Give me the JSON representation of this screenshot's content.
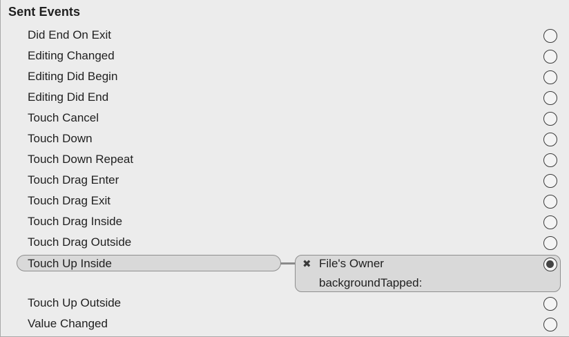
{
  "section": {
    "title": "Sent Events"
  },
  "events_before": [
    {
      "label": "Did End On Exit"
    },
    {
      "label": "Editing Changed"
    },
    {
      "label": "Editing Did Begin"
    },
    {
      "label": "Editing Did End"
    },
    {
      "label": "Touch Cancel"
    },
    {
      "label": "Touch Down"
    },
    {
      "label": "Touch Down Repeat"
    },
    {
      "label": "Touch Drag Enter"
    },
    {
      "label": "Touch Drag Exit"
    },
    {
      "label": "Touch Drag Inside"
    },
    {
      "label": "Touch Drag Outside"
    }
  ],
  "connected_event": {
    "label": "Touch Up Inside",
    "remove_icon": "✖",
    "target": "File's Owner",
    "action": "backgroundTapped:"
  },
  "events_after": [
    {
      "label": "Touch Up Outside"
    },
    {
      "label": "Value Changed"
    }
  ]
}
